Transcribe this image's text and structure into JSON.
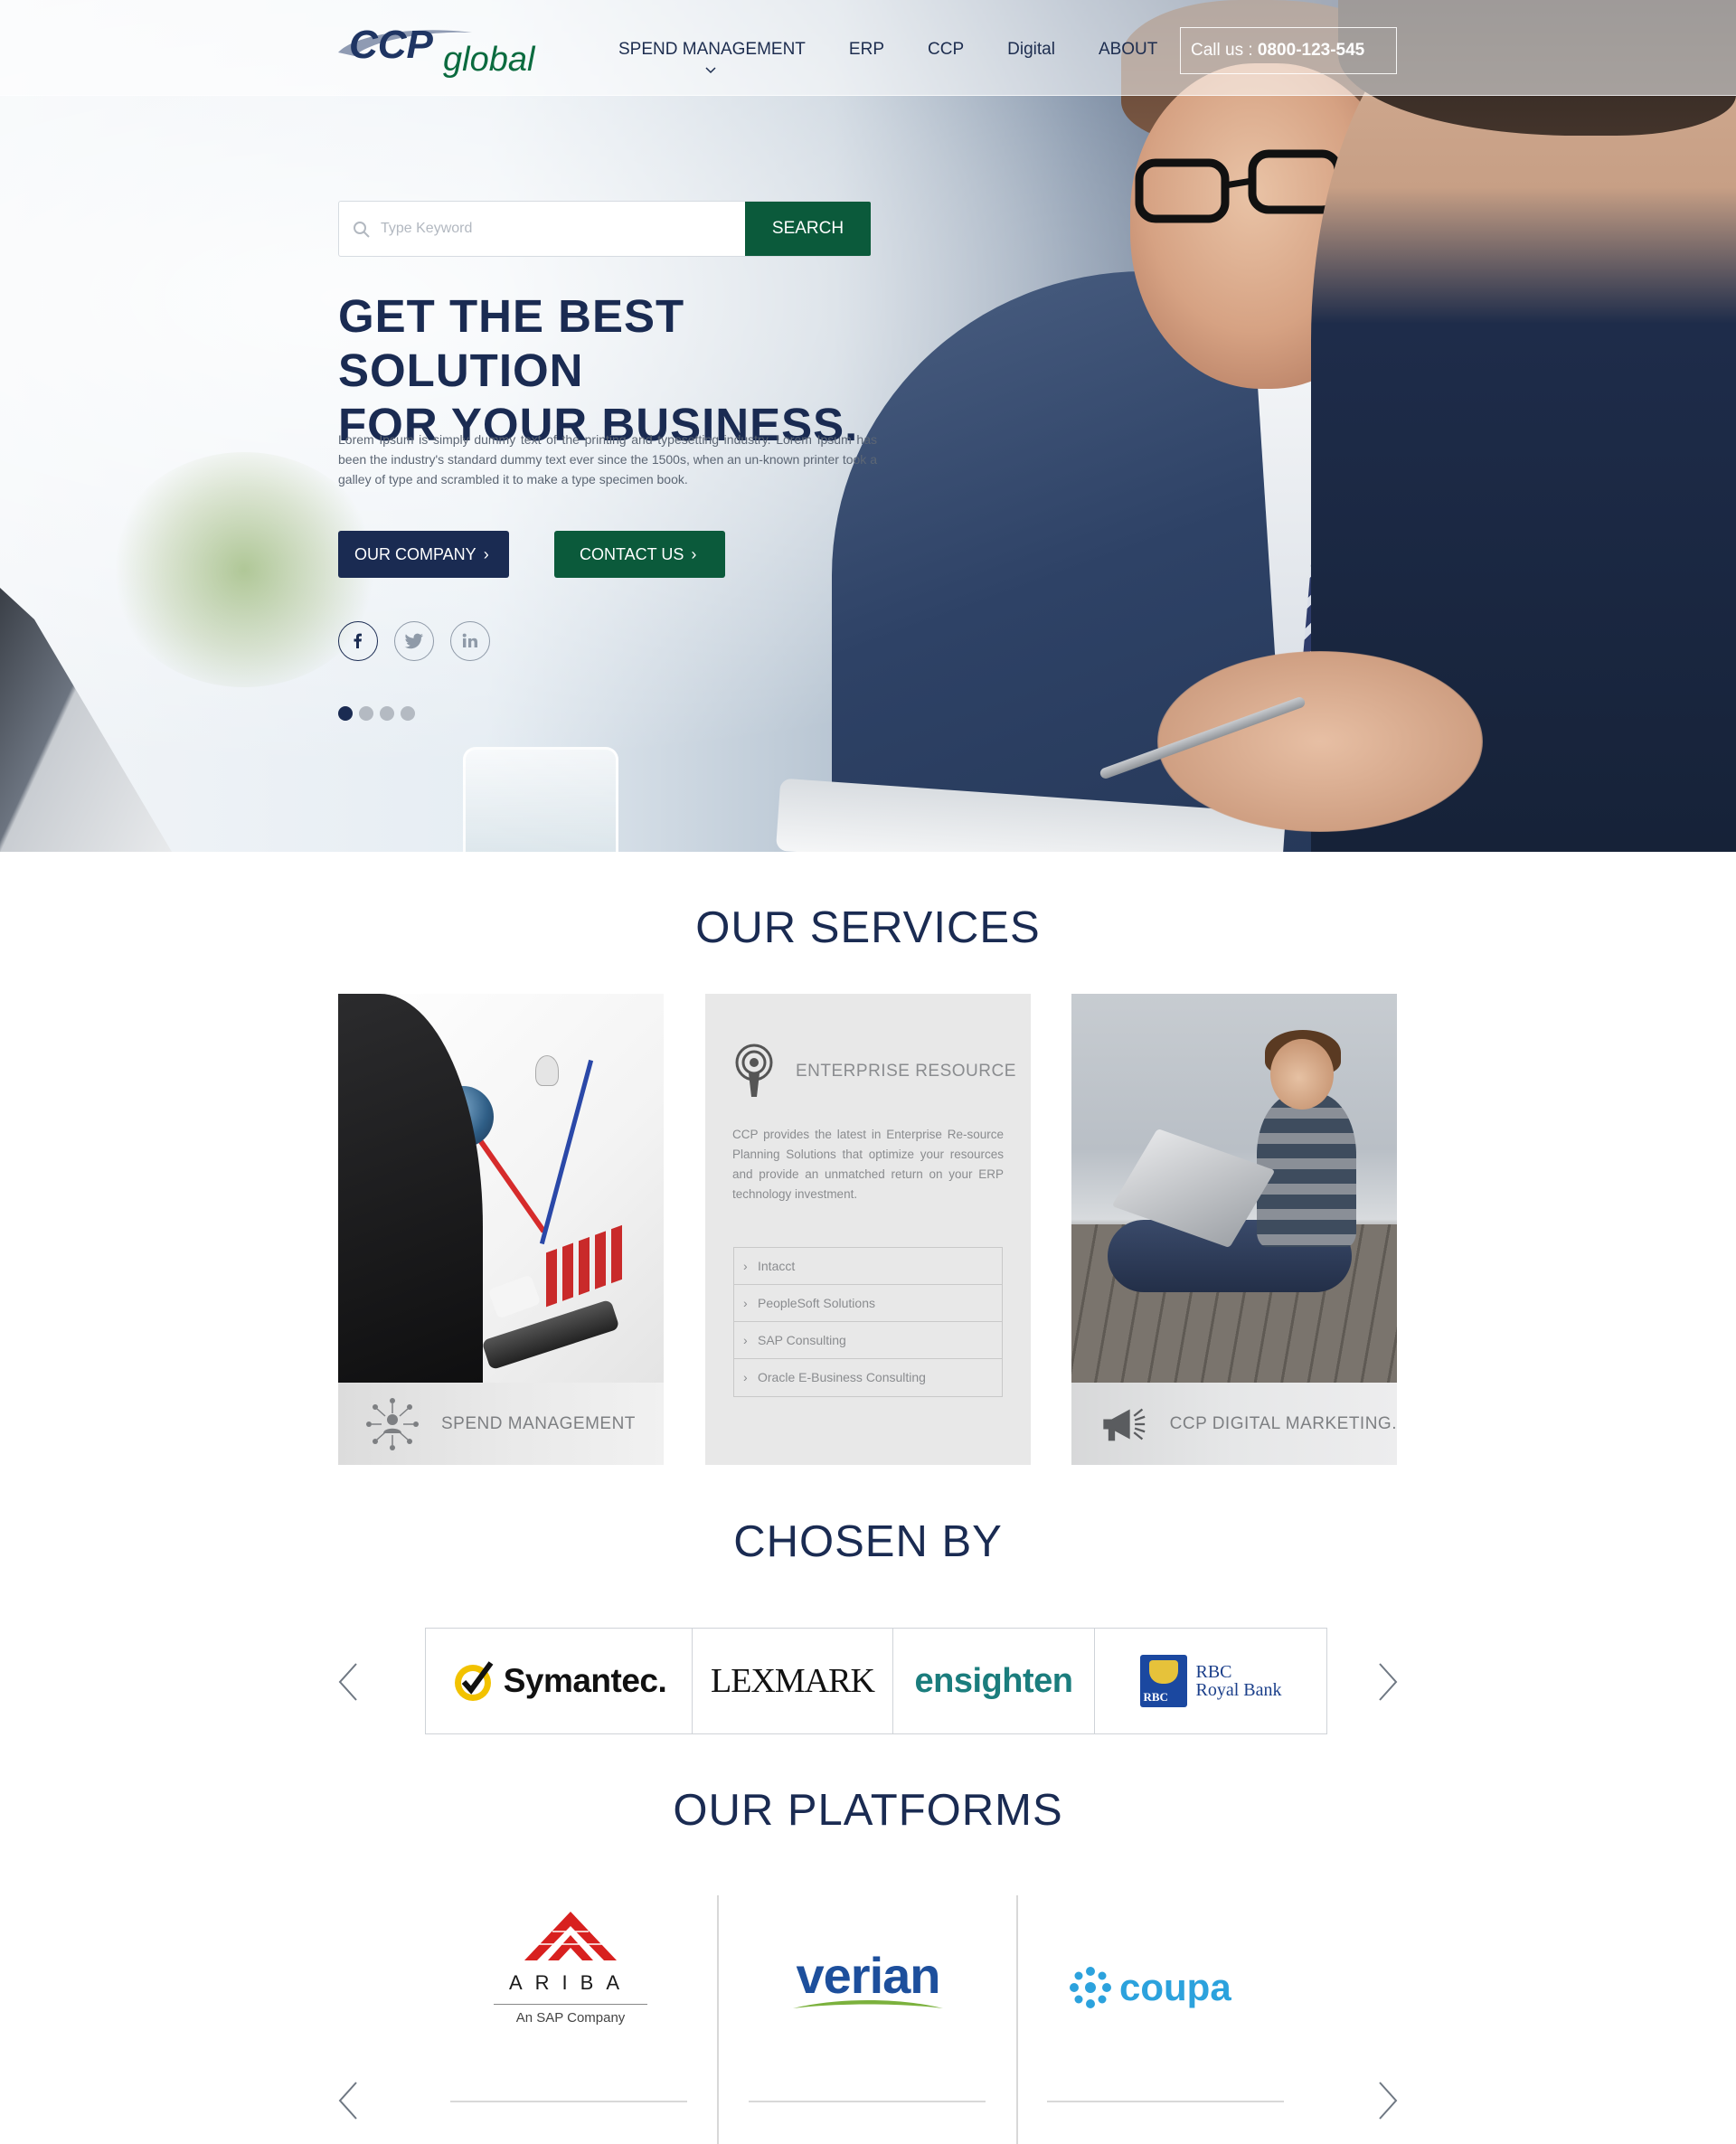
{
  "header": {
    "logo_text": "CCPglobal",
    "nav": [
      "SPEND MANAGEMENT",
      "ERP",
      "CCP",
      "Digital",
      "ABOUT"
    ],
    "call_label": "Call us :",
    "call_number": "0800-123-545"
  },
  "hero": {
    "search_placeholder": "Type Keyword",
    "search_button": "SEARCH",
    "title": "GET THE BEST SOLUTION\nFOR YOUR BUSINESS.",
    "text": "Lorem Ipsum is simply dummy text of the printing and typesetting industry. Lorem Ipsum has been the industry's standard dummy text ever since the 1500s, when an un-known printer took a galley of type and scrambled it to make a type specimen book.",
    "btn_company": "OUR COMPANY",
    "btn_contact": "CONTACT US",
    "social_icons": [
      "facebook-icon",
      "twitter-icon",
      "linkedin-icon"
    ],
    "slides_total": 4,
    "slide_active": 1
  },
  "services": {
    "title": "OUR SERVICES",
    "spend_label": "SPEND MANAGEMENT",
    "erp_label": "ENTERPRISE RESOURCE",
    "erp_text": "CCP provides the latest in Enterprise Re-source Planning Solutions that optimize your resources and provide an unmatched return on your ERP technology investment.",
    "erp_items": [
      "Intacct",
      "PeopleSoft Solutions",
      "SAP Consulting",
      "Oracle E-Business Consulting"
    ],
    "digital_label": "CCP DIGITAL MARKETING."
  },
  "chosen": {
    "title": "CHOSEN BY",
    "clients": {
      "symantec": "Symantec.",
      "lexmark": "LEXMARK",
      "ensighten": "ensighten",
      "rbc_line1": "RBC",
      "rbc_line2": "Royal Bank",
      "rbc_tag": "RBC"
    }
  },
  "platforms": {
    "title": "OUR PLATFORMS",
    "ariba": "ARIBA",
    "ariba_sub": "An SAP Company",
    "verian": "verian",
    "coupa": "coupa"
  },
  "colors": {
    "navy": "#1a2b52",
    "green": "#0b5a3b",
    "gray_text": "#8a8c8f"
  }
}
